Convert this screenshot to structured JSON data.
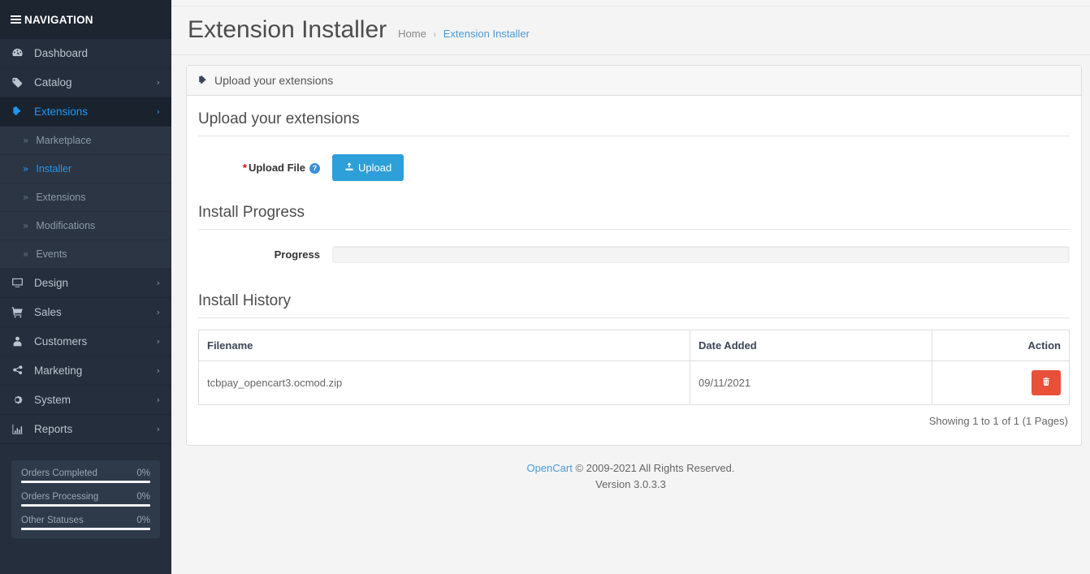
{
  "sidebar": {
    "header": "NAVIGATION",
    "items": [
      {
        "label": "Dashboard",
        "icon": "dashboard-icon",
        "caret": false,
        "active": false
      },
      {
        "label": "Catalog",
        "icon": "tag-icon",
        "caret": true,
        "active": false
      },
      {
        "label": "Extensions",
        "icon": "puzzle-icon",
        "caret": true,
        "active": true
      },
      {
        "label": "Design",
        "icon": "monitor-icon",
        "caret": true,
        "active": false
      },
      {
        "label": "Sales",
        "icon": "cart-icon",
        "caret": true,
        "active": false
      },
      {
        "label": "Customers",
        "icon": "user-icon",
        "caret": true,
        "active": false
      },
      {
        "label": "Marketing",
        "icon": "share-icon",
        "caret": true,
        "active": false
      },
      {
        "label": "System",
        "icon": "gear-icon",
        "caret": true,
        "active": false
      },
      {
        "label": "Reports",
        "icon": "chart-bar-icon",
        "caret": true,
        "active": false
      }
    ],
    "subitems": [
      {
        "label": "Marketplace",
        "current": false
      },
      {
        "label": "Installer",
        "current": true
      },
      {
        "label": "Extensions",
        "current": false
      },
      {
        "label": "Modifications",
        "current": false
      },
      {
        "label": "Events",
        "current": false
      }
    ],
    "stats": [
      {
        "label": "Orders Completed",
        "value": "0%",
        "percent": 0
      },
      {
        "label": "Orders Processing",
        "value": "0%",
        "percent": 0
      },
      {
        "label": "Other Statuses",
        "value": "0%",
        "percent": 0
      }
    ],
    "caret_glyph": "›",
    "chevron_glyph": "»"
  },
  "header": {
    "title": "Extension Installer",
    "breadcrumb_home": "Home",
    "breadcrumb_sep": "›",
    "breadcrumb_current": "Extension Installer"
  },
  "card": {
    "head_title": "Upload your extensions",
    "upload_section": {
      "legend": "Upload your extensions",
      "field_label": "Upload File",
      "required_marker": "*",
      "help_glyph": "?",
      "upload_button": "Upload"
    },
    "progress_section": {
      "legend": "Install Progress",
      "label": "Progress",
      "percent": 0
    },
    "history_section": {
      "legend": "Install History",
      "columns": [
        "Filename",
        "Date Added",
        "Action"
      ],
      "rows": [
        {
          "filename": "tcbpay_opencart3.ocmod.zip",
          "date_added": "09/11/2021",
          "action": "delete"
        }
      ],
      "pagination": "Showing 1 to 1 of 1 (1 Pages)"
    }
  },
  "footer": {
    "brand": "OpenCart",
    "copyright": "© 2009-2021 All Rights Reserved.",
    "version": "Version 3.0.3.3"
  },
  "colors": {
    "sidebar_bg": "#242e3c",
    "accent_blue": "#2196f3",
    "button_blue": "#2d9fd9",
    "danger_red": "#e8503a",
    "link_blue": "#4b9ad4",
    "required_red": "#e4000f"
  }
}
